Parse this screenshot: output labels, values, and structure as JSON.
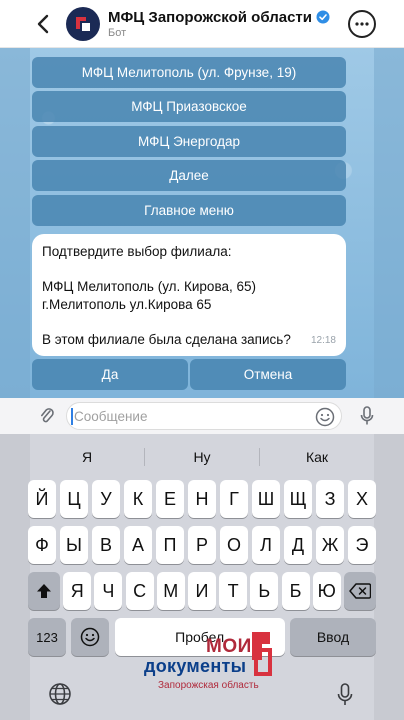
{
  "header": {
    "title": "МФЦ Запорожской области",
    "subtitle": "Бот"
  },
  "chat": {
    "buttons_top": [
      "МФЦ Мелитополь (ул. Фрунзе, 19)",
      "МФЦ Приазовское",
      "МФЦ Энергодар",
      "Далее",
      "Главное меню"
    ],
    "message": {
      "line1": "Подтвердите выбор филиала:",
      "line2": "МФЦ Мелитополь (ул. Кирова, 65)",
      "line3": "г.Мелитополь ул.Кирова 65",
      "line4": "В этом филиале была сделана запись?",
      "time": "12:18"
    },
    "buttons_bottom": [
      "Да",
      "Отмена"
    ]
  },
  "input": {
    "placeholder": "Сообщение"
  },
  "keyboard": {
    "suggestions": [
      "Я",
      "Ну",
      "Как"
    ],
    "row1": [
      "Й",
      "Ц",
      "У",
      "К",
      "Е",
      "Н",
      "Г",
      "Ш",
      "Щ",
      "З",
      "Х"
    ],
    "row2": [
      "Ф",
      "Ы",
      "В",
      "А",
      "П",
      "Р",
      "О",
      "Л",
      "Д",
      "Ж",
      "Э"
    ],
    "row3": [
      "Я",
      "Ч",
      "С",
      "М",
      "И",
      "Т",
      "Ь",
      "Б",
      "Ю"
    ],
    "numbers_label": "123",
    "space_label": "Пробел",
    "enter_label": "Ввод"
  },
  "logo": {
    "line1": "МОИ",
    "line2": "документы",
    "line3": "Запорожская область"
  },
  "colors": {
    "chat_background": "#8fbfe0",
    "inline_button": "#4682af",
    "brand_red": "#b02a3b",
    "brand_blue": "#0b3f8a",
    "verified": "#2f8ee6"
  }
}
